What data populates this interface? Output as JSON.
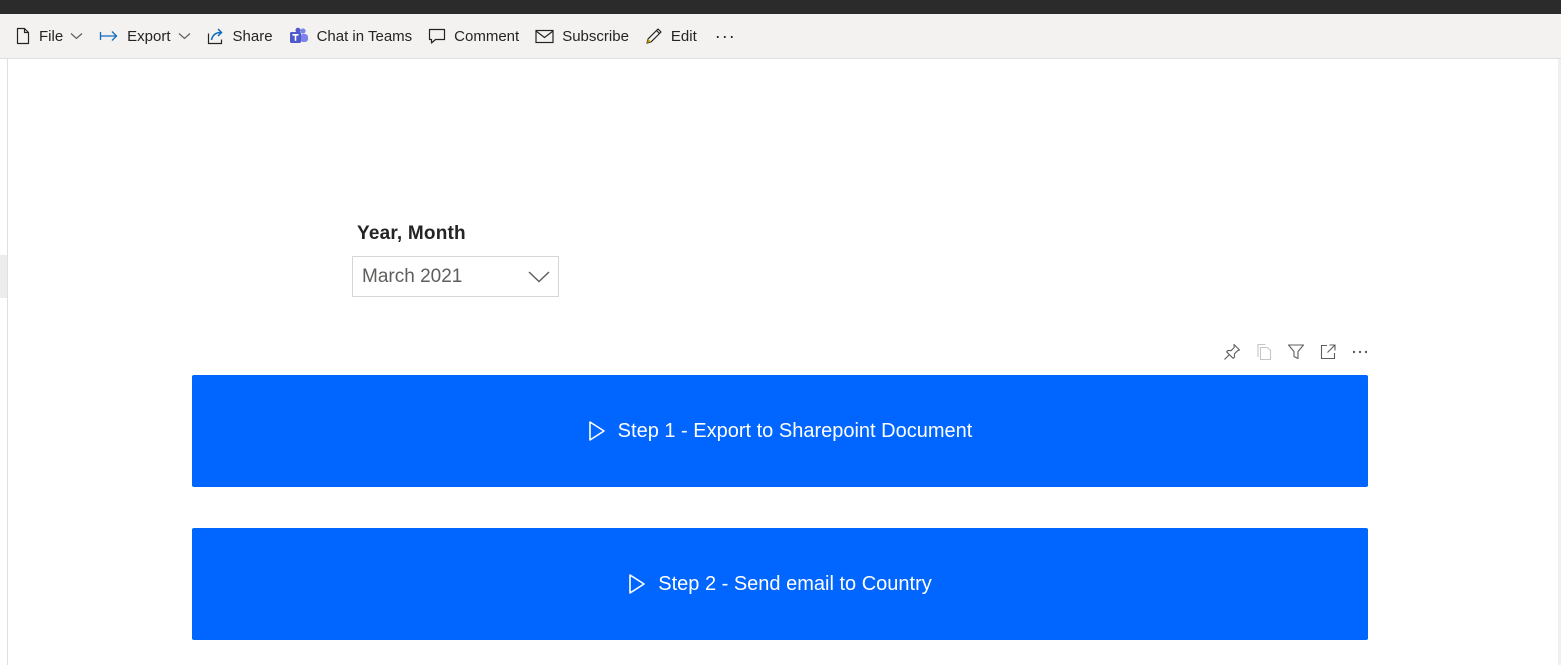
{
  "toolbar": {
    "file_label": "File",
    "export_label": "Export",
    "share_label": "Share",
    "chat_label": "Chat in Teams",
    "comment_label": "Comment",
    "subscribe_label": "Subscribe",
    "edit_label": "Edit",
    "more_label": "···"
  },
  "slicer": {
    "title": "Year, Month",
    "selected_value": "March 2021"
  },
  "visual_header": {
    "icons": [
      "pin-icon",
      "copy-icon",
      "filter-icon",
      "focus-mode-icon",
      "more-options-icon"
    ],
    "more_label": "···"
  },
  "buttons": {
    "step1_label": "Step 1 - Export to Sharepoint Document",
    "step2_label": "Step 2 - Send email to Country"
  },
  "colors": {
    "accent": "#0066ff",
    "toolbar_bg": "#f3f2f1",
    "topbar": "#2b2b2b",
    "teams_purple": "#5059c9",
    "share_blue": "#0f6cbd"
  }
}
